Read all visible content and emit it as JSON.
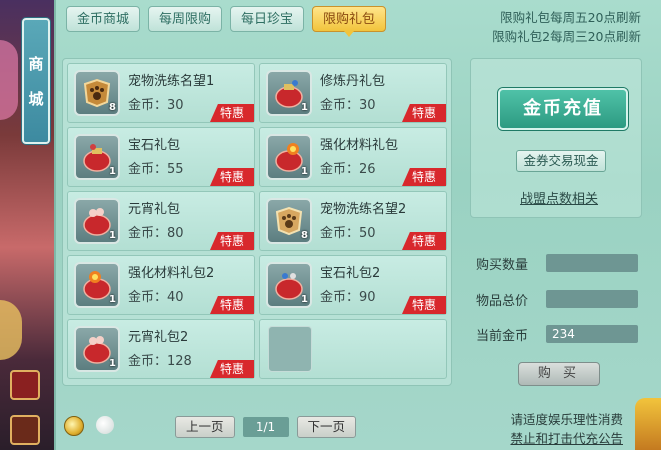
{
  "side_tab": {
    "chars": [
      "商",
      "城"
    ]
  },
  "tabs": [
    {
      "label": "金币商城",
      "active": false
    },
    {
      "label": "每周限购",
      "active": false
    },
    {
      "label": "每日珍宝",
      "active": false
    },
    {
      "label": "限购礼包",
      "active": true
    }
  ],
  "notice": {
    "line1": "限购礼包每周五20点刷新",
    "line2": "限购礼包2每周三20点刷新"
  },
  "items": [
    {
      "name": "宠物洗练名望1",
      "price": "金币：30",
      "count": "8",
      "badge": "特惠",
      "icon": "paw-badge-icon"
    },
    {
      "name": "修炼丹礼包",
      "price": "金币：30",
      "count": "1",
      "badge": "特惠",
      "icon": "gift-bag-icon"
    },
    {
      "name": "宝石礼包",
      "price": "金币：55",
      "count": "1",
      "badge": "特惠",
      "icon": "gift-bag-icon"
    },
    {
      "name": "强化材料礼包",
      "price": "金币：26",
      "count": "1",
      "badge": "特惠",
      "icon": "gift-bag-icon"
    },
    {
      "name": "元宵礼包",
      "price": "金币：80",
      "count": "1",
      "badge": "特惠",
      "icon": "gift-bag-icon"
    },
    {
      "name": "宠物洗练名望2",
      "price": "金币：50",
      "count": "8",
      "badge": "特惠",
      "icon": "paw-badge-icon"
    },
    {
      "name": "强化材料礼包2",
      "price": "金币：40",
      "count": "1",
      "badge": "特惠",
      "icon": "gift-bag-icon"
    },
    {
      "name": "宝石礼包2",
      "price": "金币：90",
      "count": "1",
      "badge": "特惠",
      "icon": "gift-bag-icon"
    },
    {
      "name": "元宵礼包2",
      "price": "金币：128",
      "count": "1",
      "badge": "特惠",
      "icon": "gift-bag-icon"
    }
  ],
  "pager": {
    "prev": "上一页",
    "page": "1/1",
    "next": "下一页"
  },
  "right": {
    "recharge": "金币充值",
    "exchange": "金券交易现金",
    "alliance": "战盟点数相关",
    "buy_qty_label": "购买数量",
    "buy_qty_value": "",
    "total_label": "物品总价",
    "total_value": "",
    "coins_label": "当前金币",
    "coins_value": "234",
    "buy": "购 买"
  },
  "tips": {
    "line1": "请适度娱乐理性消费",
    "line2": "禁止和打击代充公告"
  },
  "colors": {
    "accent": "#2d9a82",
    "badge": "#d8282c",
    "active_tab": "#f2c43c"
  }
}
